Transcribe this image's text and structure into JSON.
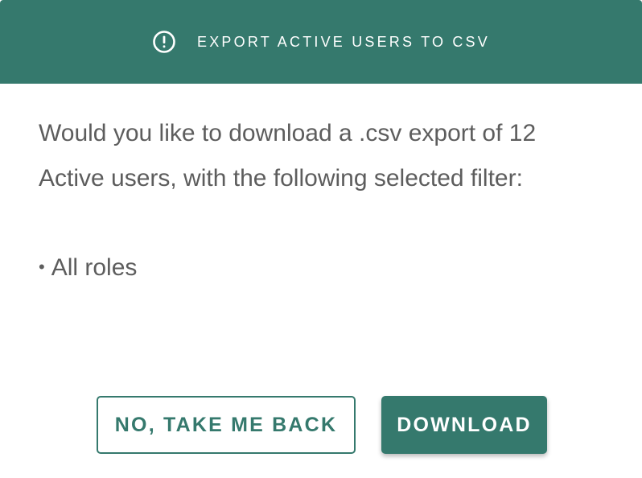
{
  "dialog": {
    "title": "EXPORT ACTIVE USERS TO CSV",
    "title_icon": "alert-circle-icon",
    "message_line_1": "Would you like to download a .csv export of 12",
    "message_line_2": "Active users, with the following selected filter:",
    "filters": [
      {
        "bullet": "•",
        "label": "All roles"
      }
    ],
    "cancel_label": "NO, TAKE ME BACK",
    "confirm_label": "DOWNLOAD"
  },
  "colors": {
    "accent": "#35796d",
    "text": "#5d5d5d",
    "background": "#ffffff"
  }
}
